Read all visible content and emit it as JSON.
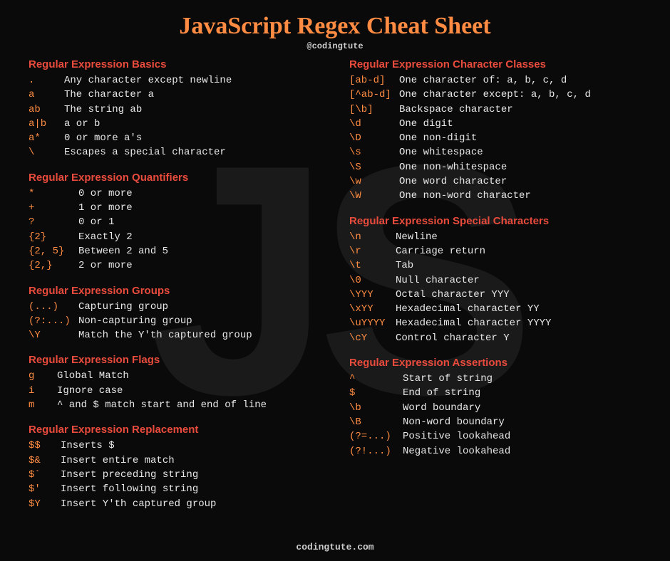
{
  "title": "JavaScript Regex Cheat Sheet",
  "subtitle": "@codingtute",
  "footer": "codingtute.com",
  "bg": "JS",
  "left": [
    {
      "title": "Regular Expression Basics",
      "cls": "basics",
      "rows": [
        {
          "k": ".",
          "v": "Any character except newline"
        },
        {
          "k": "a",
          "v": "The character a"
        },
        {
          "k": "ab",
          "v": "The string ab"
        },
        {
          "k": "a|b",
          "v": "a or b"
        },
        {
          "k": "a*",
          "v": "0 or more a's"
        },
        {
          "k": "\\",
          "v": "Escapes a special character"
        }
      ]
    },
    {
      "title": "Regular Expression Quantifiers",
      "cls": "quant",
      "rows": [
        {
          "k": "*",
          "v": "0 or more"
        },
        {
          "k": "+",
          "v": "1 or more"
        },
        {
          "k": "?",
          "v": "0 or 1"
        },
        {
          "k": "{2}",
          "v": "Exactly 2"
        },
        {
          "k": "{2, 5}",
          "v": "Between 2 and 5"
        },
        {
          "k": "{2,}",
          "v": "2 or more"
        }
      ]
    },
    {
      "title": "Regular Expression Groups",
      "cls": "groups",
      "rows": [
        {
          "k": "(...)",
          "v": "Capturing group"
        },
        {
          "k": "(?:...)",
          "v": "Non-capturing group"
        },
        {
          "k": "\\Y",
          "v": "Match the Y'th captured group"
        }
      ]
    },
    {
      "title": "Regular Expression Flags",
      "cls": "flags",
      "rows": [
        {
          "k": "g",
          "v": "Global Match"
        },
        {
          "k": "i",
          "v": "Ignore case"
        },
        {
          "k": "m",
          "v": "^ and $ match start and end of line"
        }
      ]
    },
    {
      "title": "Regular Expression Replacement",
      "cls": "replacement",
      "rows": [
        {
          "k": "$$",
          "v": "Inserts $"
        },
        {
          "k": "$&",
          "v": "Insert entire match"
        },
        {
          "k": "$`",
          "v": "Insert preceding string"
        },
        {
          "k": "$'",
          "v": "Insert following string"
        },
        {
          "k": "$Y",
          "v": "Insert Y'th captured group"
        }
      ]
    }
  ],
  "right": [
    {
      "title": "Regular Expression Character Classes",
      "cls": "classes",
      "rows": [
        {
          "k": "[ab-d]",
          "v": "One character of: a, b, c, d"
        },
        {
          "k": "[^ab-d]",
          "v": "One character except: a, b, c, d"
        },
        {
          "k": "[\\b]",
          "v": "Backspace character"
        },
        {
          "k": "\\d",
          "v": "One digit"
        },
        {
          "k": "\\D",
          "v": "One non-digit"
        },
        {
          "k": "\\s",
          "v": "One whitespace"
        },
        {
          "k": "\\S",
          "v": "One non-whitespace"
        },
        {
          "k": "\\w",
          "v": "One word character"
        },
        {
          "k": "\\W",
          "v": "One non-word character"
        }
      ]
    },
    {
      "title": "Regular Expression Special Characters",
      "cls": "special",
      "rows": [
        {
          "k": "\\n",
          "v": "Newline"
        },
        {
          "k": "\\r",
          "v": "Carriage return"
        },
        {
          "k": "\\t",
          "v": "Tab"
        },
        {
          "k": "\\0",
          "v": "Null character"
        },
        {
          "k": "\\YYY",
          "v": "Octal character YYY"
        },
        {
          "k": "\\xYY",
          "v": "Hexadecimal character YY"
        },
        {
          "k": "\\uYYYY",
          "v": "Hexadecimal character YYYY"
        },
        {
          "k": "\\cY",
          "v": "Control character Y"
        }
      ]
    },
    {
      "title": "Regular Expression Assertions",
      "cls": "assertions",
      "rows": [
        {
          "k": "^",
          "v": "Start of string"
        },
        {
          "k": "$",
          "v": "End of string"
        },
        {
          "k": "\\b",
          "v": "Word boundary"
        },
        {
          "k": "\\B",
          "v": "Non-word boundary"
        },
        {
          "k": "(?=...)",
          "v": "Positive lookahead"
        },
        {
          "k": "(?!...)",
          "v": "Negative lookahead"
        }
      ]
    }
  ]
}
